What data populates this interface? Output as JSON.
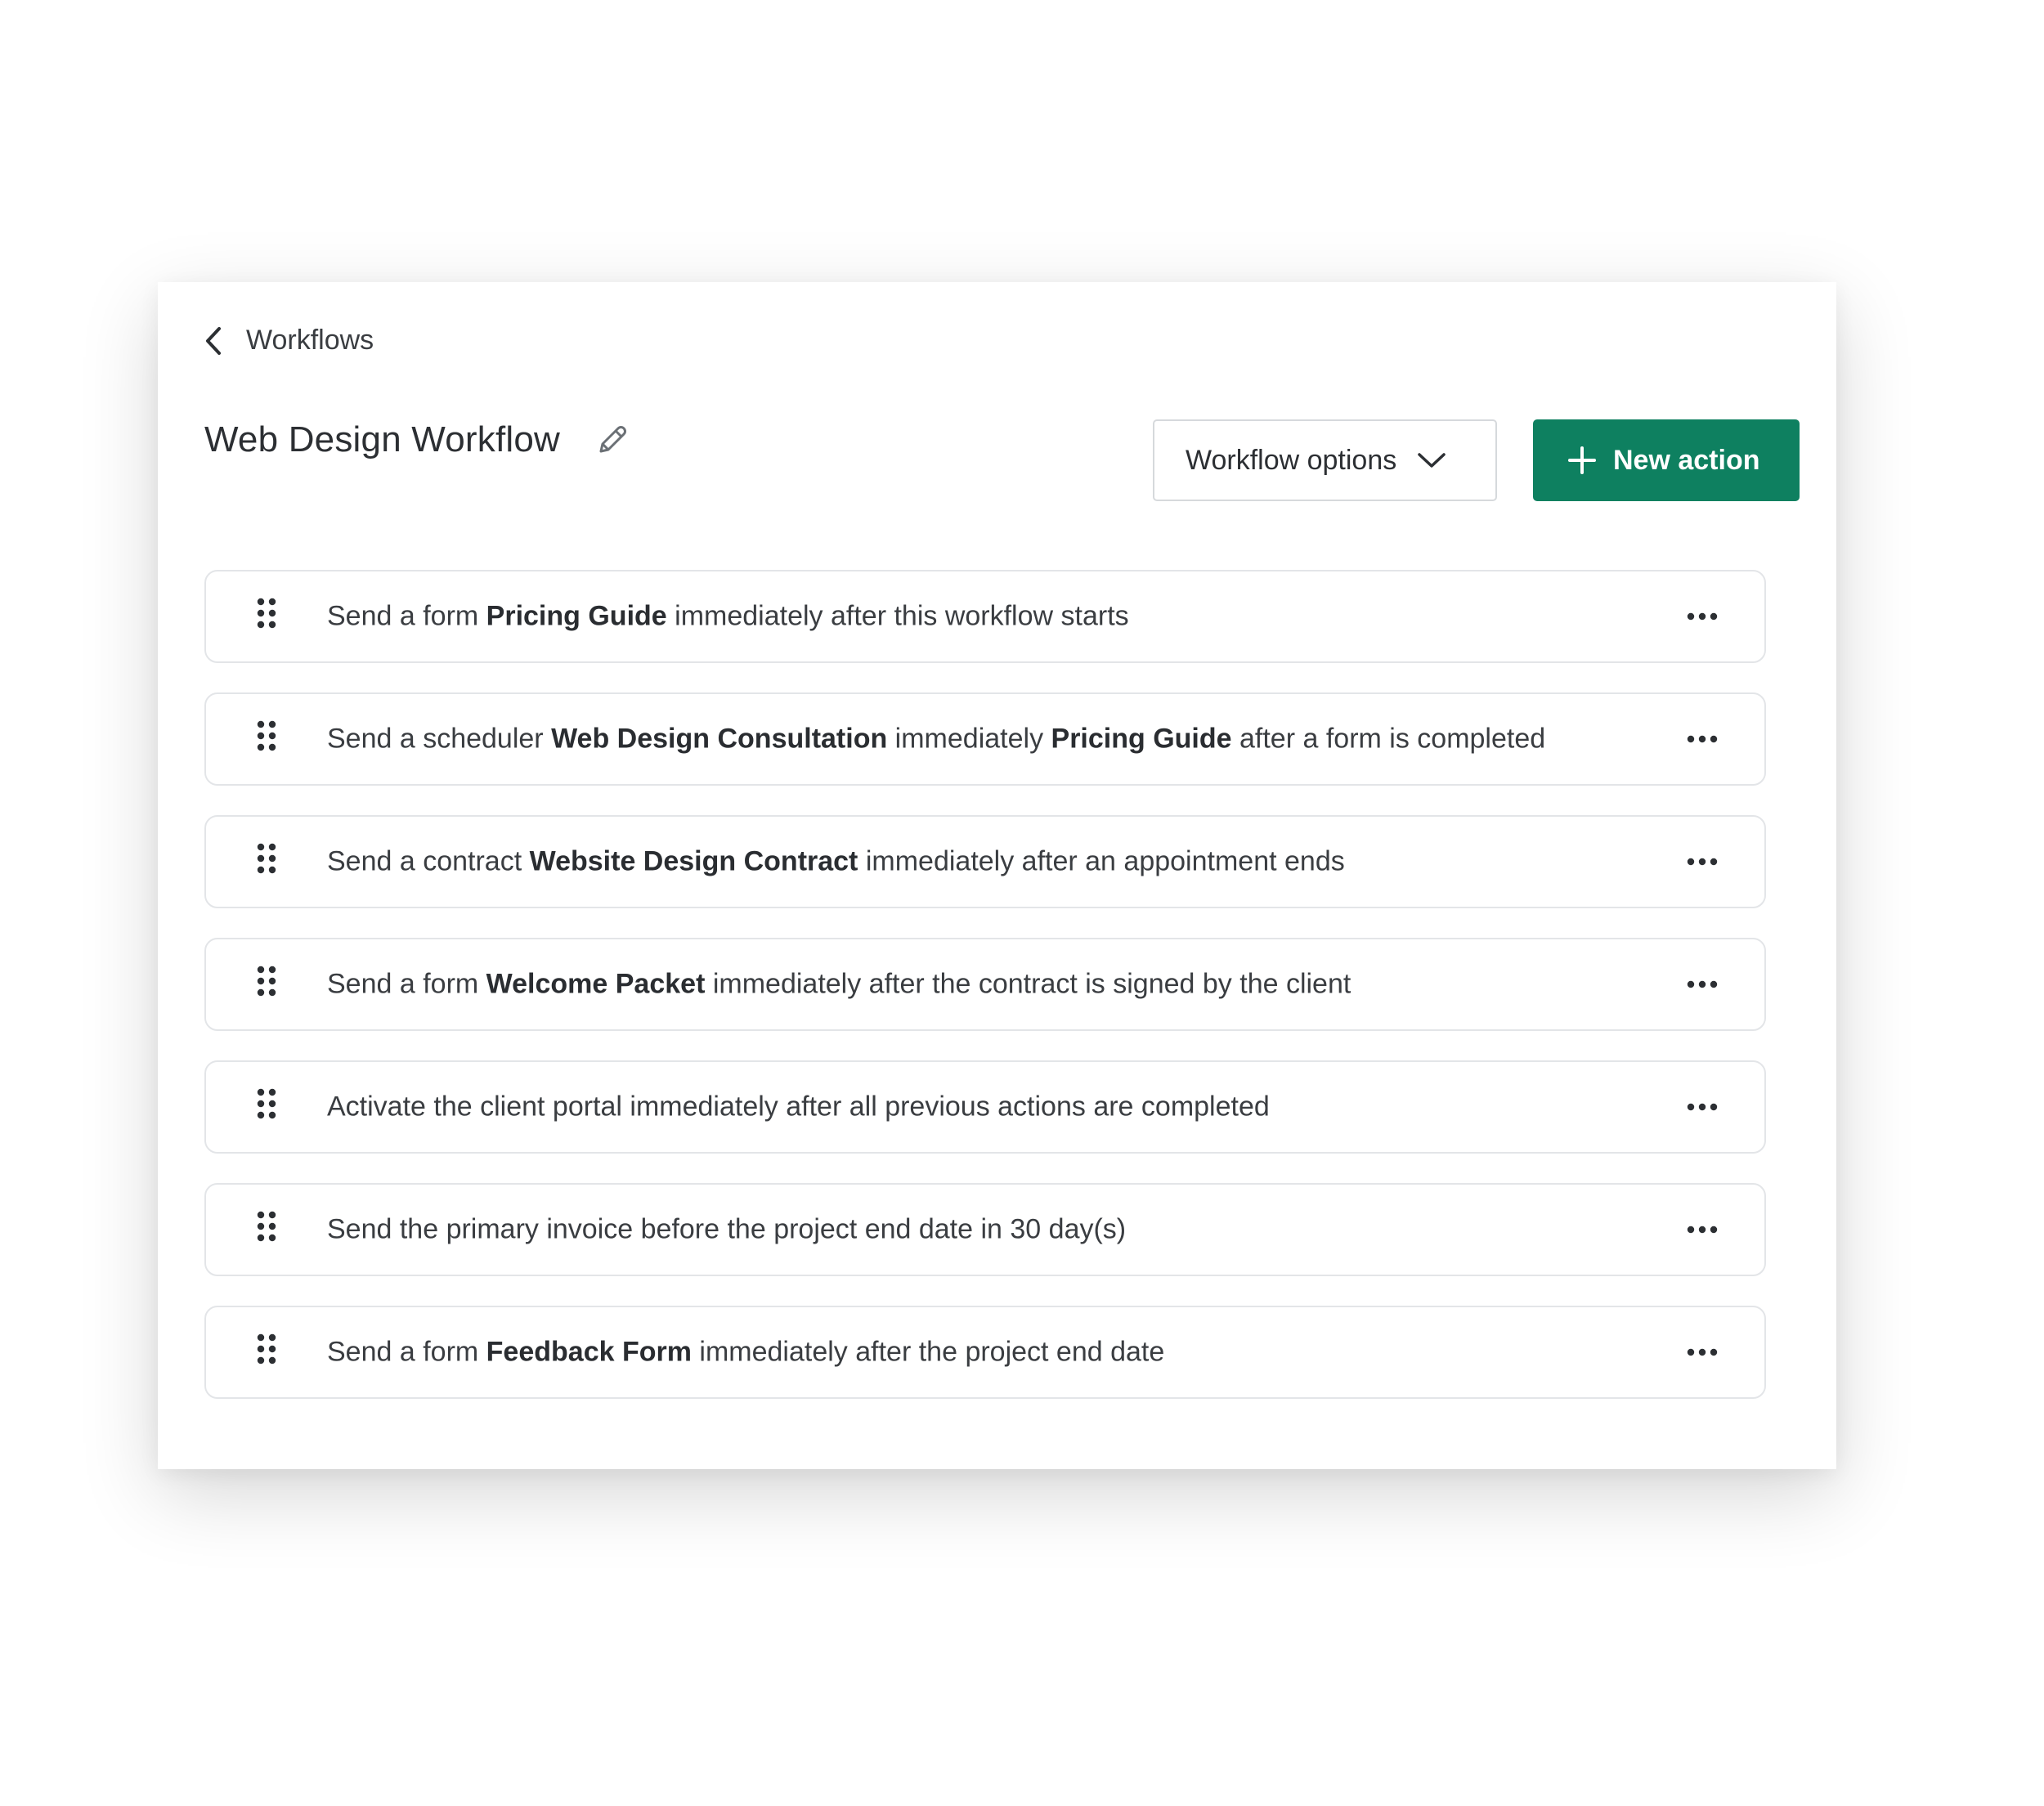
{
  "header": {
    "back_label": "Workflows",
    "title": "Web Design Workflow",
    "options_label": "Workflow options",
    "new_action_label": "New action"
  },
  "colors": {
    "accent": "#0e8060",
    "text": "#3a3d41",
    "border": "#e3e5e8"
  },
  "icons": {
    "back": "chevron-left-icon",
    "edit": "pencil-icon",
    "options": "chevron-down-icon",
    "new_action": "plus-icon",
    "drag": "drag-handle-icon",
    "more": "more-horizontal-icon"
  },
  "actions": [
    {
      "segments": [
        {
          "text": "Send a form ",
          "bold": false
        },
        {
          "text": "Pricing Guide",
          "bold": true
        },
        {
          "text": " immediately after this workflow starts",
          "bold": false
        }
      ]
    },
    {
      "segments": [
        {
          "text": "Send a scheduler ",
          "bold": false
        },
        {
          "text": "Web Design Consultation",
          "bold": true
        },
        {
          "text": " immediately ",
          "bold": false
        },
        {
          "text": "Pricing Guide",
          "bold": true
        },
        {
          "text": " after a form is completed",
          "bold": false
        }
      ]
    },
    {
      "segments": [
        {
          "text": "Send a contract ",
          "bold": false
        },
        {
          "text": "Website Design Contract",
          "bold": true
        },
        {
          "text": " immediately after an appointment ends",
          "bold": false
        }
      ]
    },
    {
      "segments": [
        {
          "text": "Send a form ",
          "bold": false
        },
        {
          "text": "Welcome Packet",
          "bold": true
        },
        {
          "text": " immediately after the contract is signed by the client",
          "bold": false
        }
      ]
    },
    {
      "segments": [
        {
          "text": "Activate the client portal immediately after all previous actions are completed",
          "bold": false
        }
      ]
    },
    {
      "segments": [
        {
          "text": "Send the primary invoice before the project end date in 30 day(s)",
          "bold": false
        }
      ]
    },
    {
      "segments": [
        {
          "text": "Send a form ",
          "bold": false
        },
        {
          "text": "Feedback Form",
          "bold": true
        },
        {
          "text": " immediately after the project end date",
          "bold": false
        }
      ]
    }
  ]
}
